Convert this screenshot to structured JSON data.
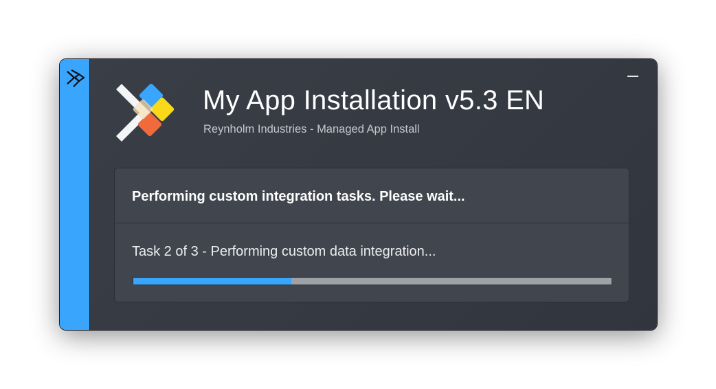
{
  "window": {
    "title": "My App Installation v5.3 EN",
    "subtitle": "Reynholm Industries - Managed App Install",
    "minimize_icon": "minimize-icon",
    "sidebar_icon": "app-chevron-icon"
  },
  "status": {
    "header": "Performing custom integration tasks. Please wait...",
    "task": "Task 2 of 3 - Performing custom data integration...",
    "progress_fraction": 0.33
  },
  "colors": {
    "accent": "#3aa5fc",
    "background": "#373b43",
    "panel": "#41454e",
    "track": "#9ea1a6"
  }
}
